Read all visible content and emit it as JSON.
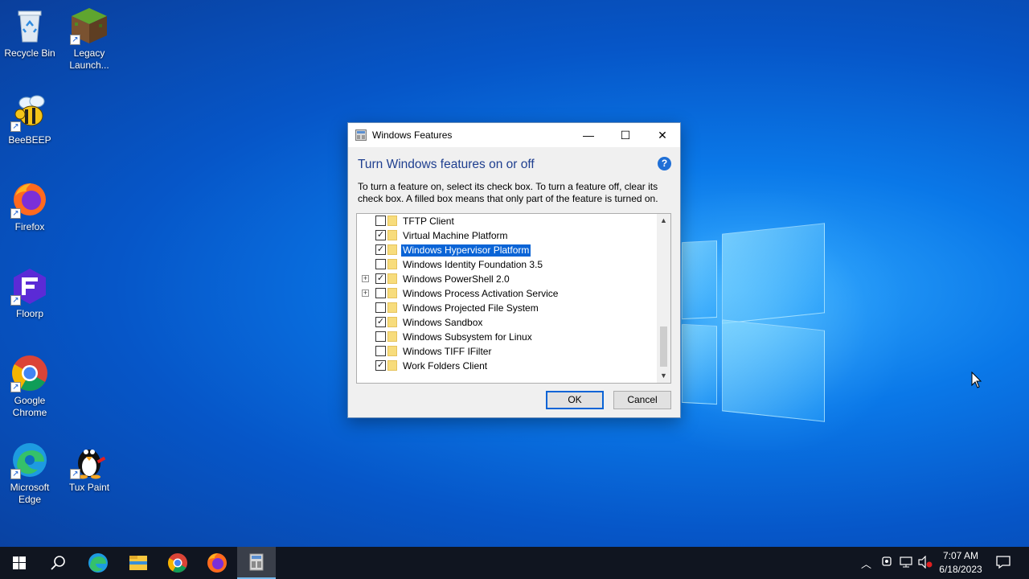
{
  "desktop": {
    "icons": [
      {
        "label": "Recycle Bin",
        "icon": "recycle-bin-icon"
      },
      {
        "label": "Legacy Launch...",
        "icon": "minecraft-block-icon"
      },
      {
        "label": "BeeBEEP",
        "icon": "bee-icon"
      },
      {
        "label": "Firefox",
        "icon": "firefox-icon"
      },
      {
        "label": "Floorp",
        "icon": "floorp-icon"
      },
      {
        "label": "Google Chrome",
        "icon": "chrome-icon"
      },
      {
        "label": "Microsoft Edge",
        "icon": "edge-icon"
      },
      {
        "label": "Tux Paint",
        "icon": "tux-icon"
      }
    ]
  },
  "window": {
    "title": "Windows Features",
    "heading": "Turn Windows features on or off",
    "description": "To turn a feature on, select its check box. To turn a feature off, clear its check box. A filled box means that only part of the feature is turned on.",
    "features": [
      {
        "label": "TFTP Client",
        "checked": false,
        "expandable": false,
        "selected": false
      },
      {
        "label": "Virtual Machine Platform",
        "checked": true,
        "expandable": false,
        "selected": false
      },
      {
        "label": "Windows Hypervisor Platform",
        "checked": true,
        "expandable": false,
        "selected": true
      },
      {
        "label": "Windows Identity Foundation 3.5",
        "checked": false,
        "expandable": false,
        "selected": false
      },
      {
        "label": "Windows PowerShell 2.0",
        "checked": true,
        "expandable": true,
        "selected": false
      },
      {
        "label": "Windows Process Activation Service",
        "checked": false,
        "expandable": true,
        "selected": false
      },
      {
        "label": "Windows Projected File System",
        "checked": false,
        "expandable": false,
        "selected": false
      },
      {
        "label": "Windows Sandbox",
        "checked": true,
        "expandable": false,
        "selected": false
      },
      {
        "label": "Windows Subsystem for Linux",
        "checked": false,
        "expandable": false,
        "selected": false
      },
      {
        "label": "Windows TIFF IFilter",
        "checked": false,
        "expandable": false,
        "selected": false
      },
      {
        "label": "Work Folders Client",
        "checked": true,
        "expandable": false,
        "selected": false
      }
    ],
    "ok_label": "OK",
    "cancel_label": "Cancel",
    "help_glyph": "?",
    "minimize_glyph": "—",
    "maximize_glyph": "☐",
    "close_glyph": "✕"
  },
  "taskbar": {
    "items": [
      "start-icon",
      "search-icon",
      "edge-icon",
      "file-explorer-icon",
      "chrome-icon",
      "firefox-icon",
      "windows-features-icon"
    ],
    "time": "7:07 AM",
    "date": "6/18/2023"
  },
  "colors": {
    "accent": "#0a64d6",
    "heading": "#1f3f8f",
    "taskbar": "#101520"
  }
}
